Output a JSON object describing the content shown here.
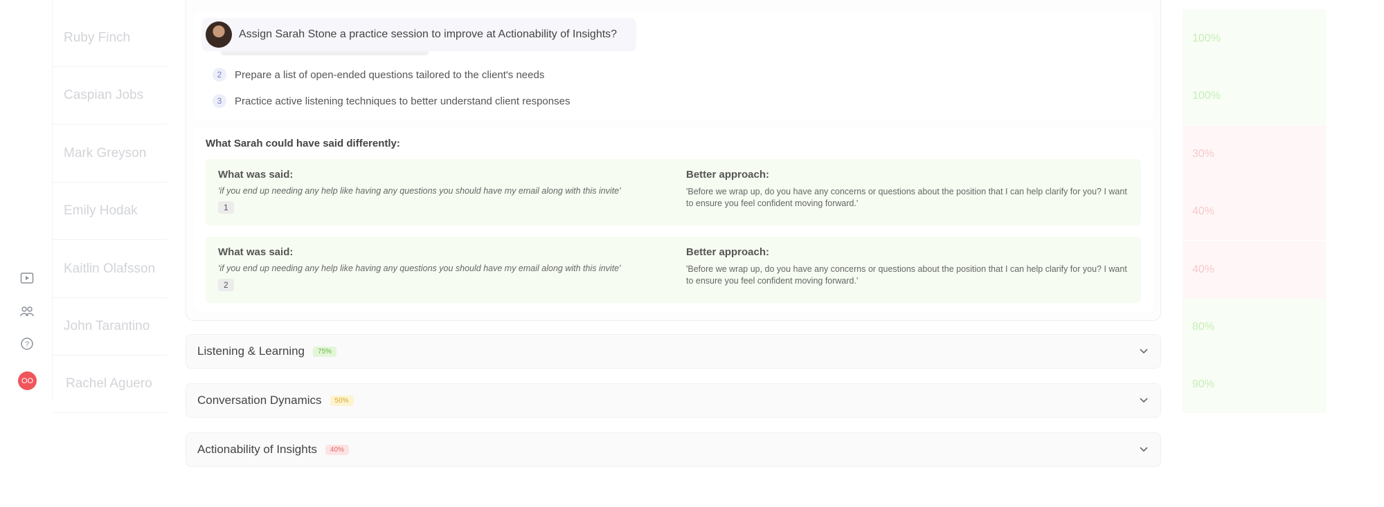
{
  "rail": {
    "icons": [
      "video-icon",
      "users-icon",
      "help-icon"
    ],
    "avatar_initials": "OO"
  },
  "people": [
    {
      "name": "Ruby Finch",
      "score": "100%",
      "status": "good"
    },
    {
      "name": "Caspian Jobs",
      "score": "100%",
      "status": "good"
    },
    {
      "name": "Mark Greyson",
      "score": "30%",
      "status": "bad"
    },
    {
      "name": "Emily Hodak",
      "score": "40%",
      "status": "bad"
    },
    {
      "name": "Kaitlin Olafsson",
      "score": "40%",
      "status": "bad"
    },
    {
      "name": "John Tarantino",
      "score": "80%",
      "status": "good"
    },
    {
      "name": "Rachel Aguero",
      "score": "90%",
      "status": "good"
    }
  ],
  "assign": {
    "text": "Assign Sarah Stone a practice session to improve at Actionability of Insights?"
  },
  "steps": [
    {
      "num": "2",
      "text": "Prepare a list of open-ended questions tailored to the client's needs"
    },
    {
      "num": "3",
      "text": "Practice active listening techniques to better understand client responses"
    }
  ],
  "differently": {
    "title": "What Sarah could have said differently:",
    "said_label": "What was said:",
    "better_label": "Better approach:",
    "items": [
      {
        "said": "'if you end up needing any help  like having any questions  you should have  my email along  with this invite'",
        "better": "'Before we wrap up, do you have any concerns or questions about the position that I can help clarify for you? I want to ensure you feel confident moving forward.'",
        "badge": "1"
      },
      {
        "said": "'if you end up needing any help  like having any questions  you should have  my email along  with this invite'",
        "better": "'Before we wrap up, do you have any concerns or questions about the position that I can help clarify for you? I want to ensure you feel confident moving forward.'",
        "badge": "2"
      }
    ]
  },
  "sections": [
    {
      "title": "Listening & Learning",
      "badge": "75%",
      "color": "green"
    },
    {
      "title": "Conversation Dynamics",
      "badge": "50%",
      "color": "yellow"
    },
    {
      "title": "Actionability of Insights",
      "badge": "40%",
      "color": "red"
    }
  ]
}
